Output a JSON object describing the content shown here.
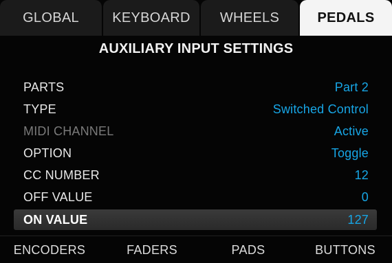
{
  "tabs": [
    {
      "label": "GLOBAL",
      "active": false
    },
    {
      "label": "KEYBOARD",
      "active": false
    },
    {
      "label": "WHEELS",
      "active": false
    },
    {
      "label": "PEDALS",
      "active": true
    }
  ],
  "heading": "AUXILIARY INPUT SETTINGS",
  "settings": [
    {
      "label": "PARTS",
      "value": "Part 2",
      "dimmed": false,
      "selected": false
    },
    {
      "label": "TYPE",
      "value": "Switched Control",
      "dimmed": false,
      "selected": false
    },
    {
      "label": "MIDI CHANNEL",
      "value": "Active",
      "dimmed": true,
      "selected": false
    },
    {
      "label": "OPTION",
      "value": "Toggle",
      "dimmed": false,
      "selected": false
    },
    {
      "label": "CC NUMBER",
      "value": "12",
      "dimmed": false,
      "selected": false
    },
    {
      "label": "OFF VALUE",
      "value": "0",
      "dimmed": false,
      "selected": false
    },
    {
      "label": "ON VALUE",
      "value": "127",
      "dimmed": false,
      "selected": true
    }
  ],
  "bottom_buttons": [
    {
      "label": "ENCODERS"
    },
    {
      "label": "FADERS"
    },
    {
      "label": "PADS"
    },
    {
      "label": "BUTTONS"
    }
  ],
  "colors": {
    "value_accent": "#17a6e6",
    "active_tab_bg": "#f4f4f4",
    "background": "#050505"
  }
}
